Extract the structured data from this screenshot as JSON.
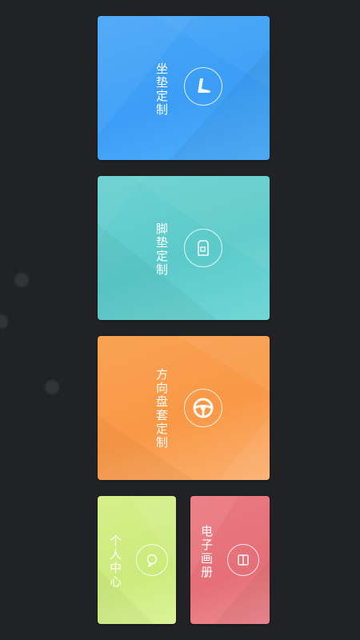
{
  "menu": {
    "seat_cushion": {
      "label": "坐垫定制",
      "icon": "seat-icon",
      "color": "#3b9df6"
    },
    "floor_mat": {
      "label": "脚垫定制",
      "icon": "floor-mat-icon",
      "color": "#5ccaca"
    },
    "steering_wheel_cover": {
      "label": "方向盘套定制",
      "icon": "steering-wheel-icon",
      "color": "#f99846"
    },
    "personal_center": {
      "label": "个人中心",
      "icon": "chat-bubble-icon",
      "color": "#cbeb7c"
    },
    "e_album": {
      "label": "电子画册",
      "icon": "book-icon",
      "color": "#e56f78"
    }
  },
  "background_color": "#212225"
}
